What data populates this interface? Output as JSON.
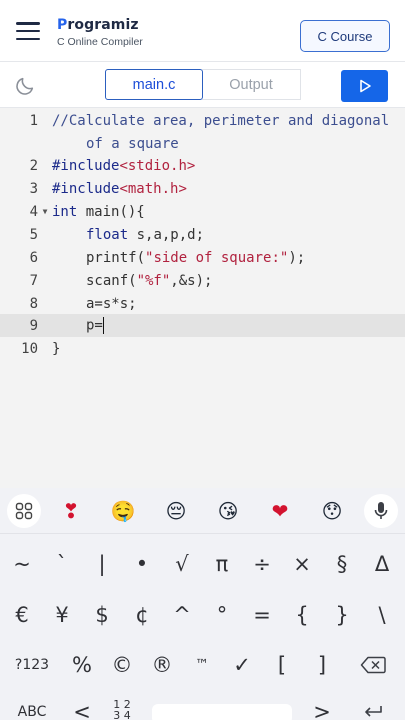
{
  "header": {
    "brand_mark": "P",
    "brand_rest": "rogramiz",
    "subtitle": "C Online Compiler",
    "course_button": "C Course"
  },
  "toolbar": {
    "tab_main": "main.c",
    "tab_output": "Output",
    "theme_icon": "moon-icon",
    "run_icon": "play-icon"
  },
  "editor": {
    "line_numbers": [
      "1",
      "2",
      "3",
      "4",
      "5",
      "6",
      "7",
      "8",
      "9",
      "10"
    ],
    "comment_line1": "//Calculate area, perimeter and diagonal",
    "comment_line2": "of a square",
    "inc1_kw": "#include",
    "inc1_hdr": "<stdio.h>",
    "inc2_kw": "#include",
    "inc2_hdr": "<math.h>",
    "l4_kw": "int",
    "l4_rest": " main(){",
    "l5_kw": "float",
    "l5_rest": " s,a,p,d;",
    "l6_fn": "printf(",
    "l6_str": "\"side of square:\"",
    "l6_end": ");",
    "l7_fn": "scanf(",
    "l7_str": "\"%f\"",
    "l7_end": ",&s);",
    "l8": "a=s*s;",
    "l9": "p=",
    "l10": "}"
  },
  "keyboard": {
    "emojis": [
      "❣",
      "🤤",
      "😔",
      "😘",
      "❤",
      "😯"
    ],
    "row1": [
      "~",
      "`",
      "|",
      "•",
      "√",
      "π",
      "÷",
      "×",
      "§",
      "Δ"
    ],
    "row2": [
      "€",
      "¥",
      "$",
      "¢",
      "^",
      "°",
      "=",
      "{",
      "}",
      "\\"
    ],
    "row3": [
      "%",
      "©",
      "®",
      "™",
      "✓",
      "[",
      "]"
    ],
    "key_123": "?123",
    "key_abc": "ABC",
    "key_comma": "<",
    "key_page_top": "1 2",
    "key_page_bottom": "3 4",
    "key_period": ">"
  },
  "colors": {
    "accent": "#1566e8",
    "editor_bg": "#f3f3f3",
    "keyword": "#1b2a8a",
    "string": "#b1223f"
  }
}
